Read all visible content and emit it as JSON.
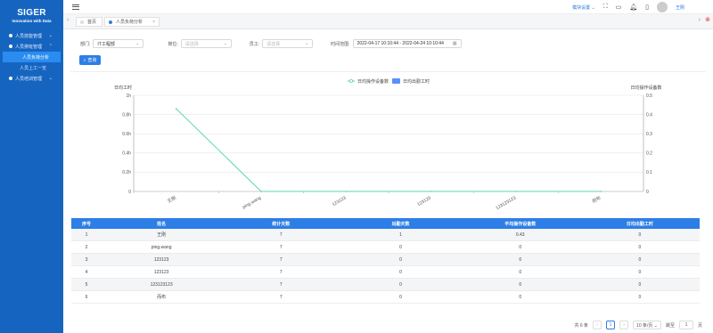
{
  "brand": {
    "title": "SIGER",
    "subtitle": "Innovation with Data"
  },
  "sidebar": {
    "items": [
      {
        "label": "人员技能管理",
        "arrow": "⌄"
      },
      {
        "label": "人员排班管理",
        "arrow": "⌃"
      },
      {
        "label": "人员负荷分析",
        "sub": true,
        "active": true
      },
      {
        "label": "人员上工一览",
        "sub": true
      },
      {
        "label": "人员培训管理",
        "arrow": "⌄"
      }
    ]
  },
  "topbar": {
    "module_label": "模块设置 ⌄",
    "user_name": "王刚"
  },
  "tabs": [
    {
      "label": "首页"
    },
    {
      "label": "人员负荷分析"
    }
  ],
  "filters": {
    "dept_label": "部门:",
    "dept_value": "IT工程部",
    "position_label": "岗位:",
    "position_placeholder": "请选择",
    "employee_label": "员工:",
    "employee_placeholder": "请选择",
    "time_label": "时间范围:",
    "time_value": "2022-04-17 10:10:44 - 2022-04-24 10:10:44"
  },
  "query_button": "查询",
  "chart_data": {
    "type": "line",
    "categories": [
      "王刚",
      "ping.wang",
      "123123",
      "123123",
      "123123123",
      "而布"
    ],
    "series": [
      {
        "name": "日均操作设备数",
        "type": "line",
        "color": "#5cd6b0",
        "axis": "right",
        "values": [
          0.43,
          0,
          0,
          0,
          0,
          0
        ]
      },
      {
        "name": "日均出勤工时",
        "type": "bar",
        "color": "#5b8ff9",
        "axis": "left",
        "values": [
          0,
          0,
          0,
          0,
          0,
          0
        ]
      }
    ],
    "ylabel_left": "日均工时",
    "ylabel_right": "日均操作设备数",
    "ylim_left": [
      0,
      1
    ],
    "ylim_right": [
      0,
      0.5
    ],
    "yticks_left": [
      "0",
      "0.2h",
      "0.4h",
      "0.6h",
      "0.8h",
      "1h"
    ],
    "yticks_right": [
      "0",
      "0.1",
      "0.2",
      "0.3",
      "0.4",
      "0.5"
    ],
    "legend": "top-center",
    "grid": true
  },
  "table": {
    "headers": [
      "序号",
      "姓名",
      "统计天数",
      "出勤天数",
      "平均操作设备数",
      "日均出勤工时"
    ],
    "rows": [
      [
        "1",
        "王刚",
        "7",
        "1",
        "0.43",
        "0"
      ],
      [
        "2",
        "ping.wang",
        "7",
        "0",
        "0",
        "0"
      ],
      [
        "3",
        "123123",
        "7",
        "0",
        "0",
        "0"
      ],
      [
        "4",
        "123123",
        "7",
        "0",
        "0",
        "0"
      ],
      [
        "5",
        "123123123",
        "7",
        "0",
        "0",
        "0"
      ],
      [
        "6",
        "而布",
        "7",
        "0",
        "0",
        "0"
      ]
    ]
  },
  "pager": {
    "total": "共 6 条",
    "current": "1",
    "size": "10 条/页 ⌄",
    "goto_label": "跳至",
    "goto_value": "1",
    "page_unit": "页"
  }
}
